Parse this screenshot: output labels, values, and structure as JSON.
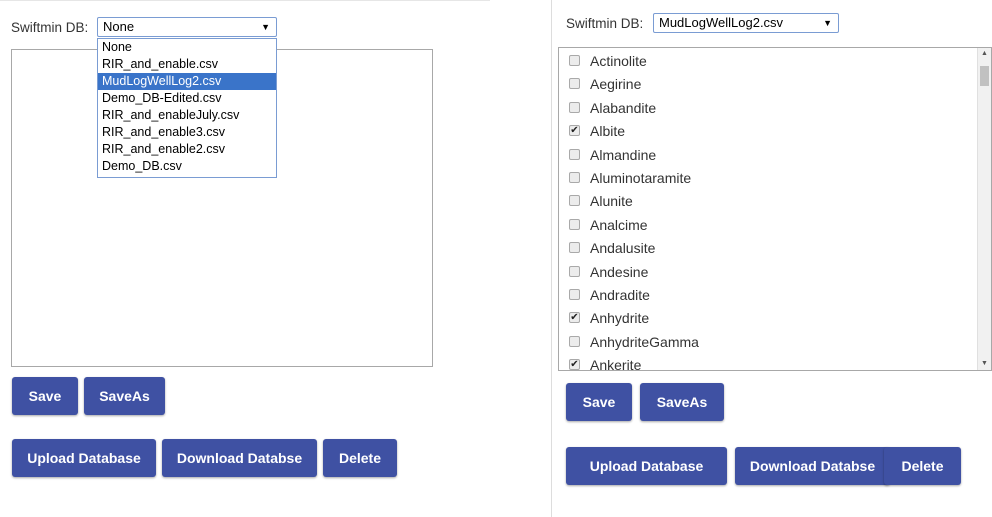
{
  "left_panel": {
    "db_label": "Swiftmin DB:",
    "db_selected": "None",
    "dropdown_options": [
      "None",
      "RIR_and_enable.csv",
      "MudLogWellLog2.csv",
      "Demo_DB-Edited.csv",
      "RIR_and_enableJuly.csv",
      "RIR_and_enable3.csv",
      "RIR_and_enable2.csv",
      "Demo_DB.csv"
    ],
    "highlighted_option": "MudLogWellLog2.csv",
    "buttons": {
      "save": "Save",
      "save_as": "SaveAs",
      "upload": "Upload Database",
      "download": "Download Databse",
      "delete": "Delete"
    }
  },
  "right_panel": {
    "db_label": "Swiftmin DB:",
    "db_selected": "MudLogWellLog2.csv",
    "minerals": [
      {
        "name": "Actinolite",
        "checked": false
      },
      {
        "name": "Aegirine",
        "checked": false
      },
      {
        "name": "Alabandite",
        "checked": false
      },
      {
        "name": "Albite",
        "checked": true
      },
      {
        "name": "Almandine",
        "checked": false
      },
      {
        "name": "Aluminotaramite",
        "checked": false
      },
      {
        "name": "Alunite",
        "checked": false
      },
      {
        "name": "Analcime",
        "checked": false
      },
      {
        "name": "Andalusite",
        "checked": false
      },
      {
        "name": "Andesine",
        "checked": false
      },
      {
        "name": "Andradite",
        "checked": false
      },
      {
        "name": "Anhydrite",
        "checked": true
      },
      {
        "name": "AnhydriteGamma",
        "checked": false
      },
      {
        "name": "Ankerite",
        "checked": true
      }
    ],
    "buttons": {
      "save": "Save",
      "save_as": "SaveAs",
      "upload": "Upload Database",
      "download": "Download Databse",
      "delete": "Delete"
    }
  },
  "colors": {
    "button": "#3f51a3",
    "highlight": "#3a74c9"
  },
  "icons": {
    "select_arrow": "▼",
    "check": "✔"
  }
}
